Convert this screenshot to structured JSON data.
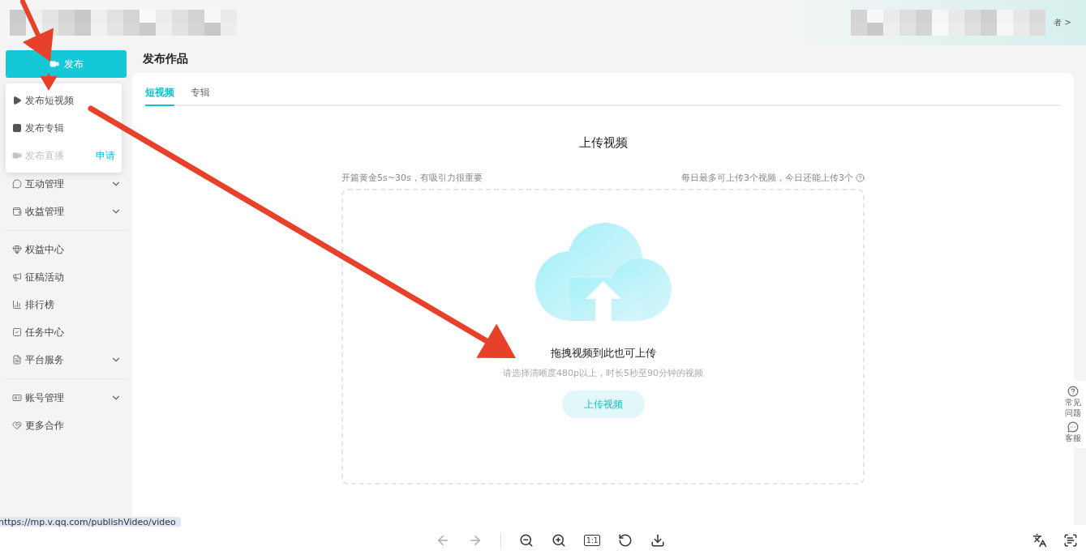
{
  "header": {
    "account_link": "者",
    "account_chevron": ">"
  },
  "publish_button": {
    "label": "发布"
  },
  "publish_menu": [
    {
      "label": "发布短视频",
      "kind": "video",
      "disabled": false
    },
    {
      "label": "发布专辑",
      "kind": "album",
      "disabled": false
    },
    {
      "label": "发布直播",
      "kind": "live",
      "disabled": true,
      "action": "申请"
    }
  ],
  "sidebar": {
    "groups": [
      [
        {
          "label": "互动管理",
          "expandable": true
        },
        {
          "label": "收益管理",
          "expandable": true
        }
      ],
      [
        {
          "label": "权益中心",
          "expandable": false
        },
        {
          "label": "征稿活动",
          "expandable": false
        },
        {
          "label": "排行榜",
          "expandable": false
        },
        {
          "label": "任务中心",
          "expandable": false
        },
        {
          "label": "平台服务",
          "expandable": true
        }
      ],
      [
        {
          "label": "账号管理",
          "expandable": true
        },
        {
          "label": "更多合作",
          "expandable": false
        }
      ]
    ]
  },
  "page": {
    "title": "发布作品",
    "tabs": [
      {
        "label": "短视频",
        "selected": true
      },
      {
        "label": "专辑",
        "selected": false
      }
    ],
    "upload": {
      "title": "上传视频",
      "tip_left": "开篇黄金5s~30s，有吸引力很重要",
      "tip_right": "每日最多可上传3个视频，今日还能上传3个",
      "drop_title": "拖拽视频到此也可上传",
      "drop_hint": "请选择清晰度480p以上，时长5秒至90分钟的视频",
      "button": "上传视频"
    }
  },
  "help_panel": [
    {
      "label": "常见问题",
      "kind": "help"
    },
    {
      "label": "客服",
      "kind": "chat"
    }
  ],
  "status_url": "https://mp.v.qq.com/publishVideo/video",
  "viewer_toolbar": {
    "actual_size": "1:1"
  }
}
